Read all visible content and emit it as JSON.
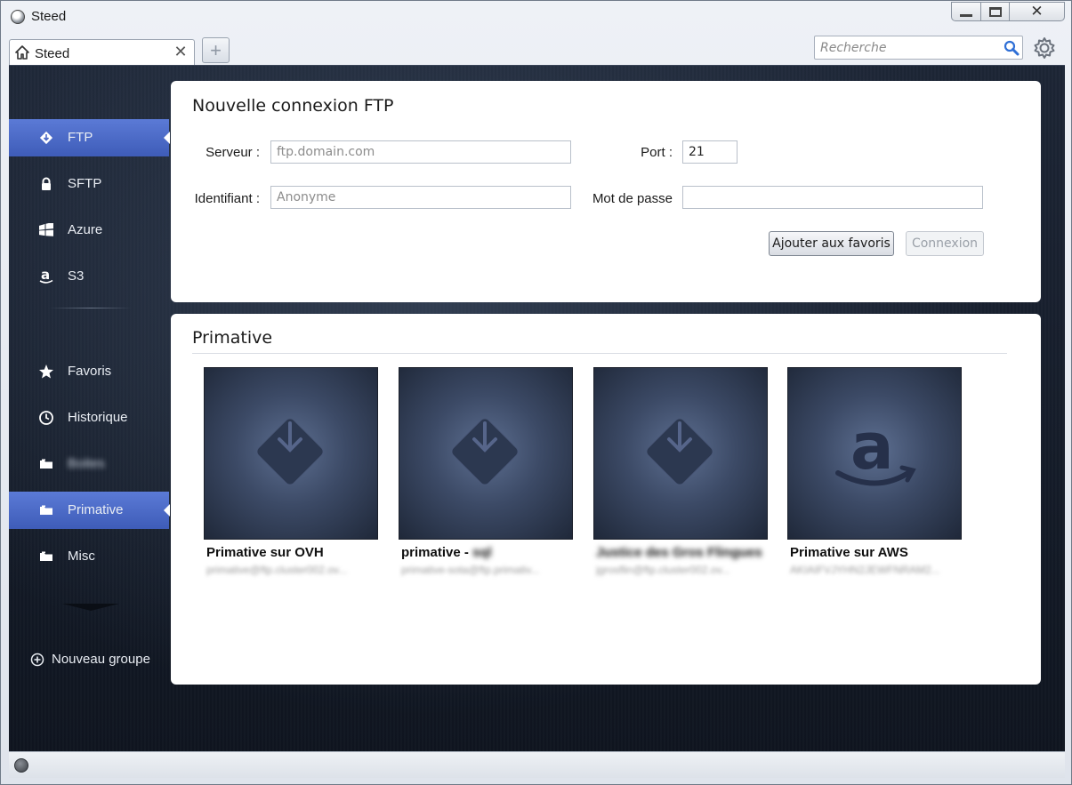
{
  "window": {
    "title": "Steed",
    "minimize_glyph": "",
    "close_glyph": "✕"
  },
  "tab": {
    "label": "Steed",
    "close_glyph": "✕",
    "add_glyph": "+"
  },
  "search": {
    "placeholder": "Recherche",
    "value": ""
  },
  "sidebar": {
    "items": [
      {
        "label": "FTP",
        "icon": "ftp-diamond-icon",
        "active": true
      },
      {
        "label": "SFTP",
        "icon": "lock-icon",
        "active": false
      },
      {
        "label": "Azure",
        "icon": "windows-icon",
        "active": false
      },
      {
        "label": "S3",
        "icon": "amazon-icon",
        "active": false
      },
      {
        "label": "Favoris",
        "icon": "star-icon",
        "active": false
      },
      {
        "label": "Historique",
        "icon": "clock-icon",
        "active": false
      },
      {
        "label": "Boites",
        "icon": "folder-icon",
        "active": false,
        "blurred": true
      },
      {
        "label": "Primative",
        "icon": "folder-icon",
        "active": true
      },
      {
        "label": "Misc",
        "icon": "folder-icon",
        "active": false
      }
    ],
    "new_group_label": "Nouveau groupe"
  },
  "ftp_form": {
    "title": "Nouvelle connexion FTP",
    "server_label": "Serveur :",
    "server_placeholder": "ftp.domain.com",
    "port_label": "Port :",
    "port_value": "21",
    "login_label": "Identifiant :",
    "login_placeholder": "Anonyme",
    "password_label": "Mot de passe",
    "password_value": "",
    "add_favorite_label": "Ajouter aux favoris",
    "connect_label": "Connexion"
  },
  "group": {
    "title": "Primative",
    "tiles": [
      {
        "name": "Primative sur OVH",
        "name_blur": "",
        "subtitle": "primative@ftp.cluster002.ov...",
        "icon": "ftp-download-icon"
      },
      {
        "name": "primative - ",
        "name_blur": "sql",
        "subtitle": "primative-sota@ftp.primativ...",
        "icon": "ftp-download-icon"
      },
      {
        "name": "",
        "name_blur": "Justice des Gros Flingues",
        "subtitle": "jgrosflin@ftp.cluster002.ov...",
        "icon": "ftp-download-icon"
      },
      {
        "name": "Primative sur AWS",
        "name_blur": "",
        "subtitle": "AKIAIFVJYHN2JEWFNRAM2...",
        "icon": "amazon-logo-icon"
      }
    ]
  },
  "colors": {
    "accent": "#4a68c6",
    "sidebar_bg": "#161e2c",
    "tile_bg": "#3c4a66"
  }
}
